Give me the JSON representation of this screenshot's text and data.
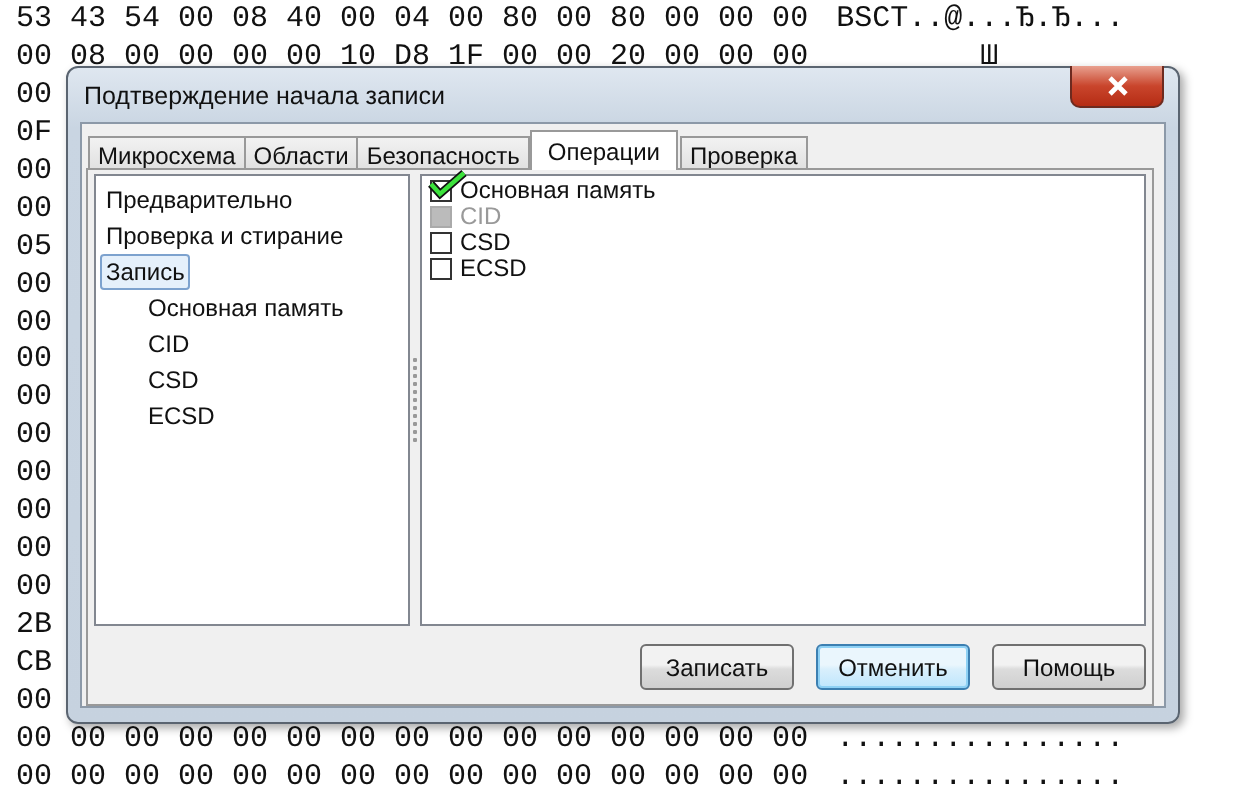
{
  "hex_rows": [
    {
      "hex": "53 43 54 00 08 40 00 04 00 80 00 80 00 00 00",
      "ascii": "BSCT..@...Ђ.Ђ..."
    },
    {
      "hex": "00 08 00 00 00 00 10 D8 1F 00 00 20 00 00 00",
      "ascii": "        Ш"
    },
    {
      "hex": "00"
    },
    {
      "hex": "0F"
    },
    {
      "hex": "00"
    },
    {
      "hex": "00"
    },
    {
      "hex": "05"
    },
    {
      "hex": "00"
    },
    {
      "hex": "00"
    },
    {
      "hex": "00"
    },
    {
      "hex": "00"
    },
    {
      "hex": "00"
    },
    {
      "hex": "00"
    },
    {
      "hex": "00"
    },
    {
      "hex": "00"
    },
    {
      "hex": "00"
    },
    {
      "hex": "2B"
    },
    {
      "hex": "CB"
    },
    {
      "hex": "00"
    },
    {
      "hex": "00 00 00 00 00 00 00 00 00 00 00 00 00 00 00",
      "ascii": "................"
    },
    {
      "hex": "00 00 00 00 00 00 00 00 00 00 00 00 00 00 00",
      "ascii": "................"
    }
  ],
  "dialog": {
    "title": "Подтверждение начала записи",
    "tabs": [
      {
        "label": "Микросхема",
        "selected": false
      },
      {
        "label": "Области",
        "selected": false
      },
      {
        "label": "Безопасность",
        "selected": false
      },
      {
        "label": "Операции",
        "selected": true
      },
      {
        "label": "Проверка",
        "selected": false
      }
    ],
    "tree": [
      {
        "label": "Предварительно",
        "selected": false
      },
      {
        "label": "Проверка и стирание",
        "selected": false
      },
      {
        "label": "Запись",
        "selected": true,
        "children": [
          {
            "label": "Основная память",
            "selected": false
          },
          {
            "label": "CID",
            "selected": false
          },
          {
            "label": "CSD",
            "selected": false
          },
          {
            "label": "ECSD",
            "selected": false
          }
        ]
      }
    ],
    "options": [
      {
        "label": "Основная память",
        "checked": true,
        "disabled": false
      },
      {
        "label": "CID",
        "checked": false,
        "disabled": true
      },
      {
        "label": "CSD",
        "checked": false,
        "disabled": false
      },
      {
        "label": "ECSD",
        "checked": false,
        "disabled": false
      }
    ],
    "buttons": [
      {
        "label": "Записать",
        "focused": false
      },
      {
        "label": "Отменить",
        "focused": true
      },
      {
        "label": "Помощь",
        "focused": false
      }
    ]
  }
}
